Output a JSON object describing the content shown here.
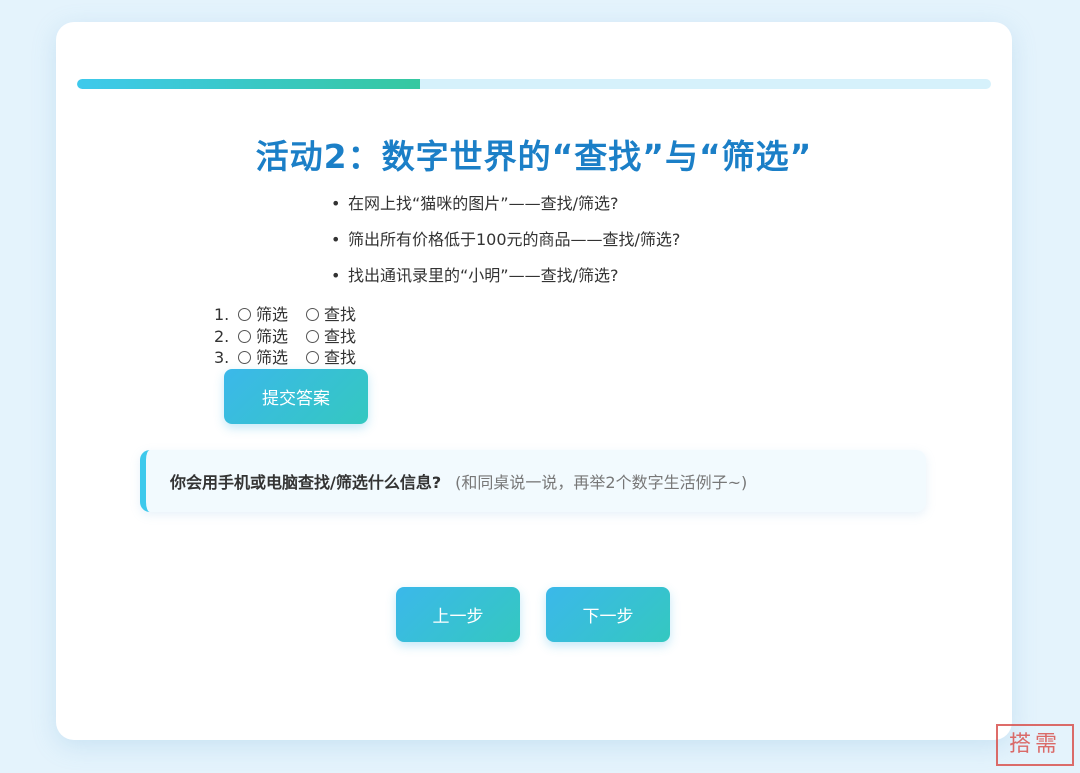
{
  "progress": {
    "value": 0.375
  },
  "title": "活动2：数字世界的“查找”与“筛选”",
  "examples": [
    "在网上找“猫咪的图片”——查找/筛选?",
    "筛出所有价格低于100元的商品——查找/筛选?",
    "找出通讯录里的“小明”——查找/筛选?"
  ],
  "bullet": "•",
  "answers": [
    {
      "number": "1.",
      "option_a": "筛选",
      "option_b": "查找"
    },
    {
      "number": "2.",
      "option_a": "筛选",
      "option_b": "查找"
    },
    {
      "number": "3.",
      "option_a": "筛选",
      "option_b": "查找"
    }
  ],
  "submit_label": "提交答案",
  "discussion": {
    "question": "你会用手机或电脑查找/筛选什么信息?",
    "hint": "(和同桌说一说，再举2个数字生活例子~)"
  },
  "nav": {
    "prev_label": "上一步",
    "next_label": "下一步"
  },
  "stamp_text": "搭需",
  "colors": {
    "accent": "#1b7fc7",
    "progress": "#3ec9ec",
    "progress_end": "#35c8a0",
    "stamp": "#d9534f"
  }
}
